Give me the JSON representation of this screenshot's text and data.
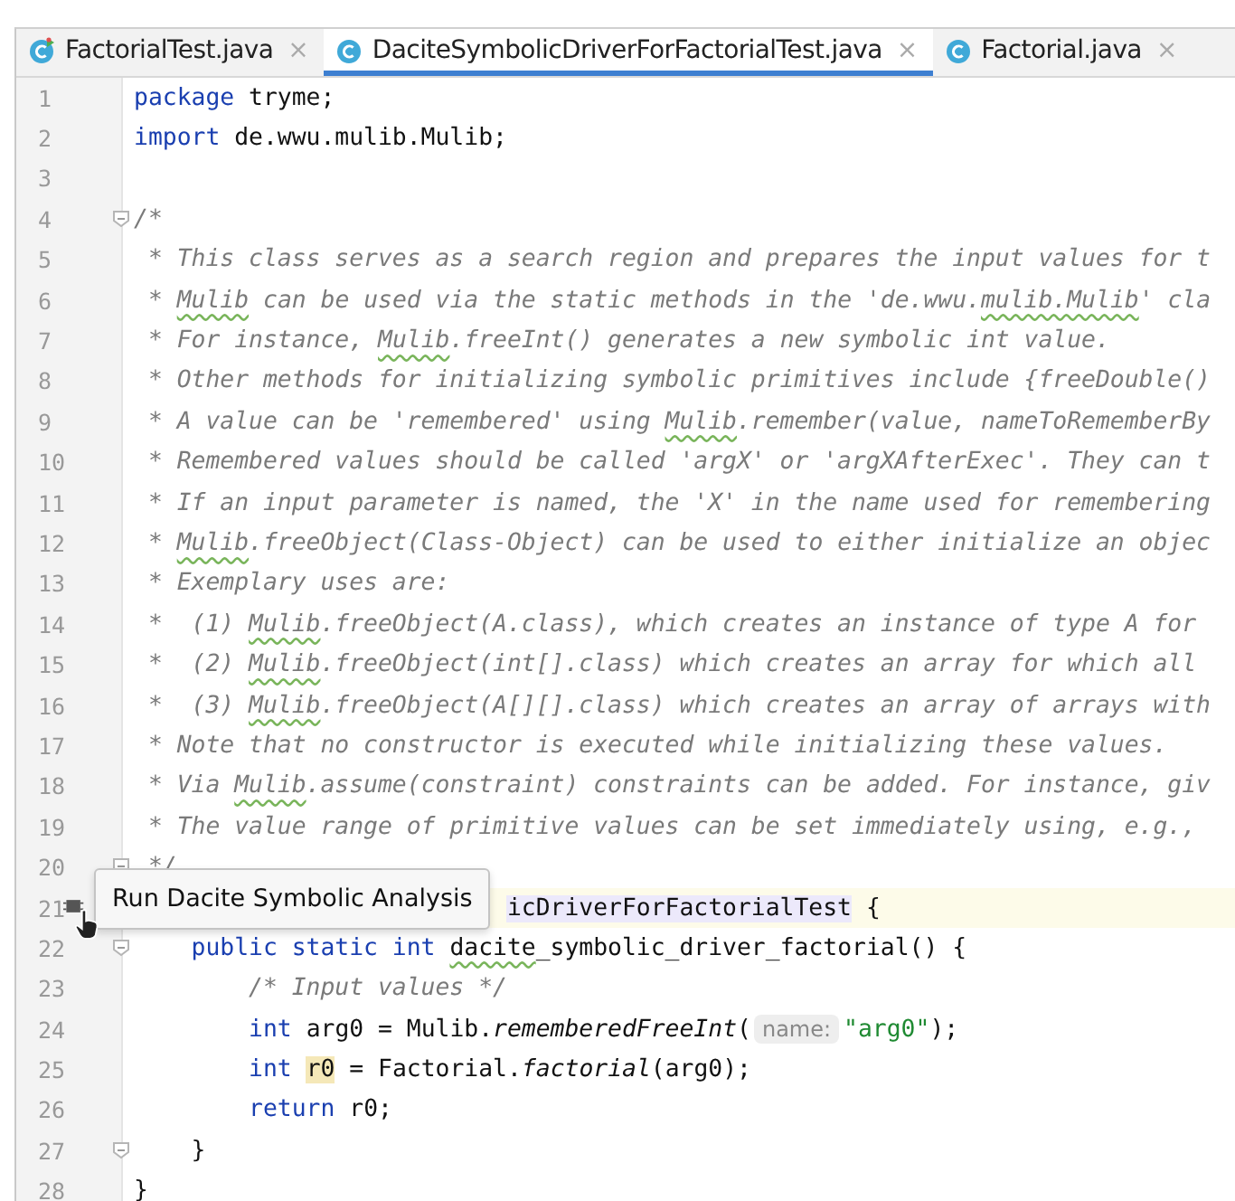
{
  "tabs": [
    {
      "label": "FactorialTest.java",
      "selected": false,
      "kind": "test",
      "close": "×"
    },
    {
      "label": "DaciteSymbolicDriverForFactorialTest.java",
      "selected": true,
      "kind": "class",
      "close": "×"
    },
    {
      "label": "Factorial.java",
      "selected": false,
      "kind": "class",
      "close": "×"
    }
  ],
  "editor": {
    "lines": [
      {
        "number": "1",
        "current": false,
        "fold": false,
        "tokens": [
          {
            "kind": "keyword",
            "text": "package"
          },
          {
            "kind": "plain",
            "text": " tryme;"
          }
        ]
      },
      {
        "number": "2",
        "current": false,
        "fold": false,
        "tokens": [
          {
            "kind": "keyword",
            "text": "import"
          },
          {
            "kind": "plain",
            "text": " de.wwu.mulib.Mulib;"
          }
        ]
      },
      {
        "number": "3",
        "current": false,
        "fold": false
      },
      {
        "number": "4",
        "current": false,
        "fold": true,
        "tokens": [
          {
            "kind": "comment",
            "text": "/*"
          }
        ]
      },
      {
        "number": "5",
        "current": false,
        "fold": false,
        "tokens": [
          {
            "kind": "comment",
            "text": " * This class serves as a search region and prepares the input values for t"
          }
        ]
      },
      {
        "number": "6",
        "current": false,
        "fold": false,
        "tokens": [
          {
            "kind": "comment",
            "text": " * "
          },
          {
            "kind": "comment_warn",
            "text": "Mulib"
          },
          {
            "kind": "comment",
            "text": " can be used via the static methods in the 'de.wwu."
          },
          {
            "kind": "comment_warn",
            "text": "mulib.Mulib"
          },
          {
            "kind": "comment",
            "text": "' cla"
          }
        ]
      },
      {
        "number": "7",
        "current": false,
        "fold": false,
        "tokens": [
          {
            "kind": "comment",
            "text": " * For instance, "
          },
          {
            "kind": "comment_warn",
            "text": "Mulib"
          },
          {
            "kind": "comment",
            "text": ".freeInt() generates a new symbolic int value."
          }
        ]
      },
      {
        "number": "8",
        "current": false,
        "fold": false,
        "tokens": [
          {
            "kind": "comment",
            "text": " * Other methods for initializing symbolic primitives include {freeDouble()"
          }
        ]
      },
      {
        "number": "9",
        "current": false,
        "fold": false,
        "tokens": [
          {
            "kind": "comment",
            "text": " * A value can be 'remembered' using "
          },
          {
            "kind": "comment_warn",
            "text": "Mulib"
          },
          {
            "kind": "comment",
            "text": ".remember(value, nameToRememberBy"
          }
        ]
      },
      {
        "number": "10",
        "current": false,
        "fold": false,
        "tokens": [
          {
            "kind": "comment",
            "text": " * Remembered values should be called 'argX' or 'argXAfterExec'. They can t"
          }
        ]
      },
      {
        "number": "11",
        "current": false,
        "fold": false,
        "tokens": [
          {
            "kind": "comment",
            "text": " * If an input parameter is named, the 'X' in the name used for remembering"
          }
        ]
      },
      {
        "number": "12",
        "current": false,
        "fold": false,
        "tokens": [
          {
            "kind": "comment",
            "text": " * "
          },
          {
            "kind": "comment_warn",
            "text": "Mulib"
          },
          {
            "kind": "comment",
            "text": ".freeObject(Class-Object) can be used to either initialize an objec"
          }
        ]
      },
      {
        "number": "13",
        "current": false,
        "fold": false,
        "tokens": [
          {
            "kind": "comment",
            "text": " * Exemplary uses are:"
          }
        ]
      },
      {
        "number": "14",
        "current": false,
        "fold": false,
        "tokens": [
          {
            "kind": "comment",
            "text": " *  (1) "
          },
          {
            "kind": "comment_warn",
            "text": "Mulib"
          },
          {
            "kind": "comment",
            "text": ".freeObject(A.class), which creates an instance of type A for"
          }
        ]
      },
      {
        "number": "15",
        "current": false,
        "fold": false,
        "tokens": [
          {
            "kind": "comment",
            "text": " *  (2) "
          },
          {
            "kind": "comment_warn",
            "text": "Mulib"
          },
          {
            "kind": "comment",
            "text": ".freeObject(int[].class) which creates an array for which all"
          }
        ]
      },
      {
        "number": "16",
        "current": false,
        "fold": false,
        "tokens": [
          {
            "kind": "comment",
            "text": " *  (3) "
          },
          {
            "kind": "comment_warn",
            "text": "Mulib"
          },
          {
            "kind": "comment",
            "text": ".freeObject(A[][].class) which creates an array of arrays with"
          }
        ]
      },
      {
        "number": "17",
        "current": false,
        "fold": false,
        "tokens": [
          {
            "kind": "comment",
            "text": " * Note that no constructor is executed while initializing these values."
          }
        ]
      },
      {
        "number": "18",
        "current": false,
        "fold": false,
        "tokens": [
          {
            "kind": "comment",
            "text": " * Via "
          },
          {
            "kind": "comment_warn",
            "text": "Mulib"
          },
          {
            "kind": "comment",
            "text": ".assume(constraint) constraints can be added. For instance, giv"
          }
        ]
      },
      {
        "number": "19",
        "current": false,
        "fold": false,
        "tokens": [
          {
            "kind": "comment",
            "text": " * The value range of primitive values can be set immediately using, e.g.,"
          }
        ]
      },
      {
        "number": "20",
        "current": false,
        "fold": true,
        "tokens": [
          {
            "kind": "comment",
            "text": " */"
          }
        ]
      },
      {
        "number": "21",
        "current": true,
        "fold": false,
        "tokens": [
          {
            "kind": "usage",
            "text": "                          icDriverForFactorialTest"
          },
          {
            "kind": "plain",
            "text": " {"
          }
        ]
      },
      {
        "number": "22",
        "current": false,
        "fold": true,
        "tokens": [
          {
            "kind": "keyword",
            "text": "    public static int"
          },
          {
            "kind": "warn",
            "text": " dacite"
          },
          {
            "kind": "plain",
            "text": "_symbolic_driver_factorial() {"
          }
        ]
      },
      {
        "number": "23",
        "current": false,
        "fold": false,
        "tokens": [
          {
            "kind": "comment",
            "text": "        /* Input values */"
          }
        ]
      },
      {
        "number": "24",
        "current": false,
        "fold": false,
        "tokens": [
          {
            "kind": "keyword",
            "text": "        int"
          },
          {
            "kind": "plain",
            "text": " arg0 = Mulib."
          },
          {
            "kind": "italic",
            "text": "rememberedFreeInt"
          },
          {
            "kind": "plain",
            "text": "("
          },
          {
            "kind": "hint",
            "text": "name:"
          },
          {
            "kind": "string",
            "text": "\"arg0\""
          },
          {
            "kind": "plain",
            "text": ");"
          }
        ]
      },
      {
        "number": "25",
        "current": false,
        "fold": false,
        "tokens": [
          {
            "kind": "keyword",
            "text": "        int"
          },
          {
            "kind": "mark",
            "text": " r0"
          },
          {
            "kind": "plain",
            "text": " = Factorial."
          },
          {
            "kind": "italic",
            "text": "factorial"
          },
          {
            "kind": "plain",
            "text": "(arg0);"
          }
        ]
      },
      {
        "number": "26",
        "current": false,
        "fold": false,
        "tokens": [
          {
            "kind": "keyword",
            "text": "        return"
          },
          {
            "kind": "plain",
            "text": " r0;"
          }
        ]
      },
      {
        "number": "27",
        "current": false,
        "fold": true,
        "tokens": [
          {
            "kind": "plain",
            "text": "    }"
          }
        ]
      },
      {
        "number": "28",
        "current": false,
        "fold": false,
        "tokens": [
          {
            "kind": "plain",
            "text": "}"
          }
        ]
      }
    ]
  },
  "tooltip": {
    "text": "Run Dacite Symbolic Analysis"
  }
}
